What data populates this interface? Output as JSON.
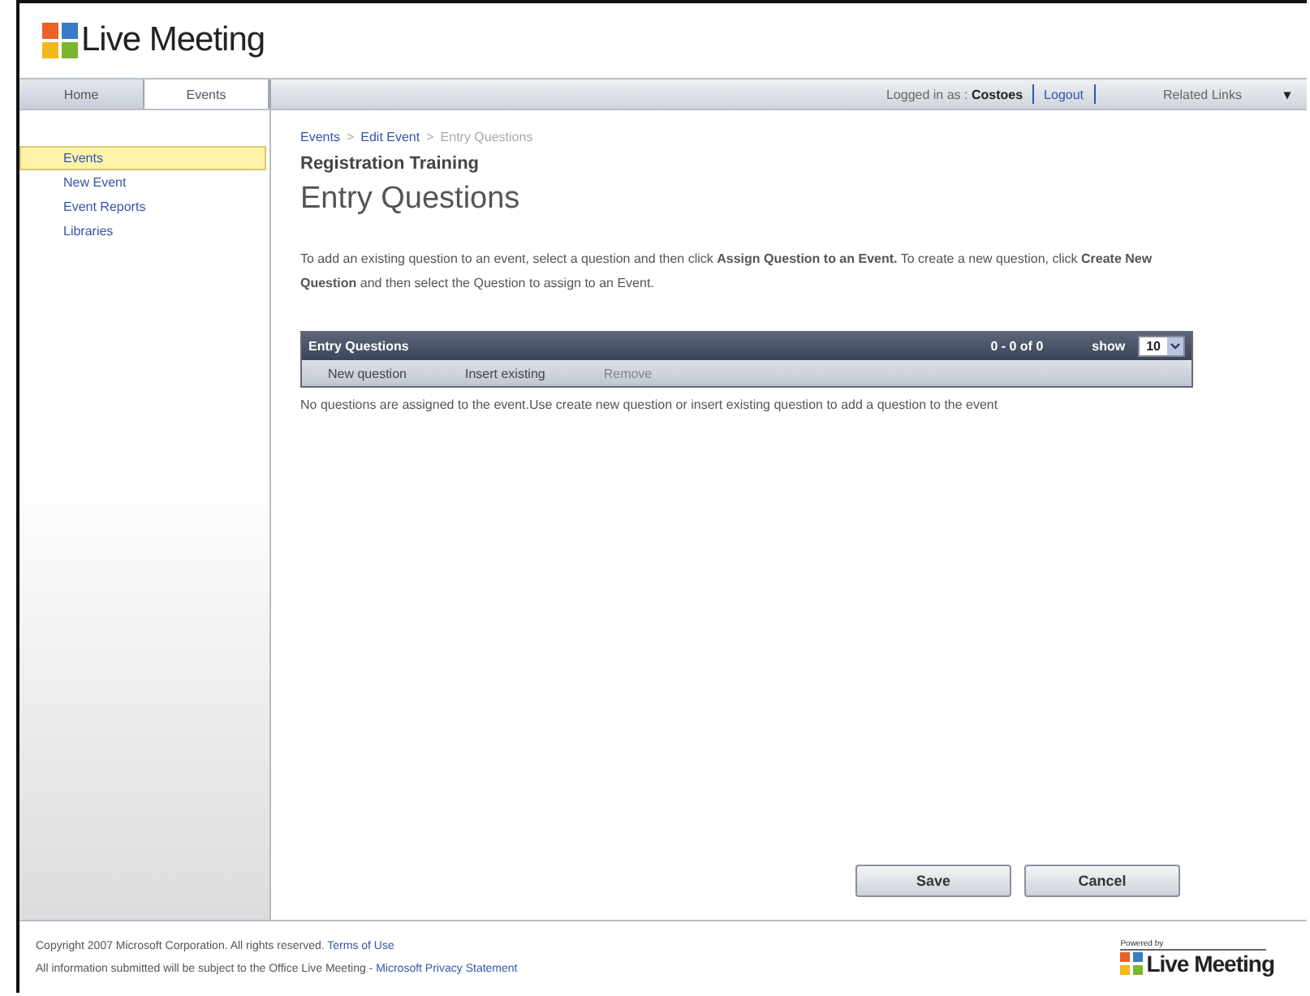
{
  "header": {
    "logo": "Live Meeting"
  },
  "tabs": [
    {
      "label": "Home",
      "selected": false
    },
    {
      "label": "Events",
      "selected": true
    }
  ],
  "top_bar": {
    "logged_in_label": "Logged in as :",
    "user": "Costoes",
    "logout": "Logout",
    "related_links": "Related Links",
    "related_caret": "▾"
  },
  "sidebar": {
    "items": [
      {
        "label": "Events",
        "selected": true
      },
      {
        "label": "New Event",
        "selected": false
      },
      {
        "label": "Event Reports",
        "selected": false
      },
      {
        "label": "Libraries",
        "selected": false
      }
    ]
  },
  "breadcrumb": [
    {
      "label": "Events",
      "link": true
    },
    {
      "label": "Edit Event",
      "link": true
    },
    {
      "label": "Entry Questions",
      "link": false
    }
  ],
  "breadcrumb_separator": ">",
  "event_name": "Registration Training",
  "page_title": "Entry Questions",
  "instructions": "To add an existing question to an event, select a question and then click **Assign Question to an Event.** To create a new question, click **Create New Question** and then select the Question to assign to an Event.",
  "panel": {
    "title": "Entry Questions",
    "count": "0 - 0 of 0",
    "show_label": "show",
    "show_value": "10",
    "actions": [
      {
        "label": "New question",
        "disabled": false
      },
      {
        "label": "Insert existing",
        "disabled": false
      },
      {
        "label": "Remove",
        "disabled": true
      }
    ],
    "empty_message": "No questions are assigned to the event.Use create new question or insert existing question to add a question to the event"
  },
  "buttons": [
    "Save",
    "Cancel"
  ],
  "footer": {
    "copyright": "Copyright 2007 Microsoft Corporation. All rights reserved.",
    "terms": "Terms of Use",
    "notice": "All information submitted will be subject to the Office Live Meeting -",
    "privacy": "Microsoft Privacy Statement",
    "powered_by": "Powered by",
    "logo": "Live Meeting"
  }
}
